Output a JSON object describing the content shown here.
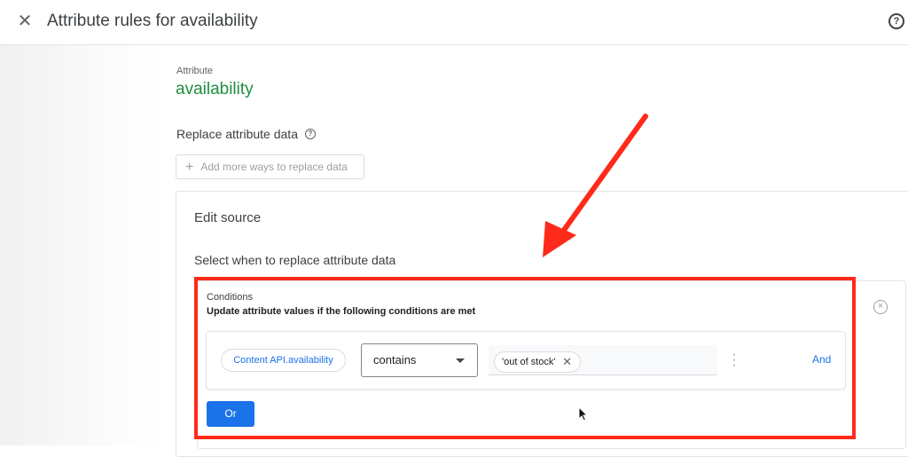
{
  "header": {
    "close_icon": "close-icon",
    "title": "Attribute rules for availability",
    "help_icon": "help-icon",
    "help_glyph": "?"
  },
  "attribute": {
    "label": "Attribute",
    "value": "availability"
  },
  "replace": {
    "title": "Replace attribute data",
    "help_glyph": "?",
    "add_plus": "+",
    "add_label": "Add more ways to replace data"
  },
  "edit_source": {
    "title": "Edit source",
    "select_when": "Select when to replace attribute data"
  },
  "conditions": {
    "label": "Conditions",
    "description": "Update attribute values if the following conditions are met",
    "remove_glyph": "×",
    "rule": {
      "field": "Content API.availability",
      "operator": "contains",
      "value_chip": "'out of stock'",
      "value_chip_remove": "✕",
      "and_label": "And"
    },
    "or_label": "Or"
  },
  "annotation": {
    "highlight_color": "#ff2a1a",
    "arrow_color": "#ff2a1a"
  }
}
